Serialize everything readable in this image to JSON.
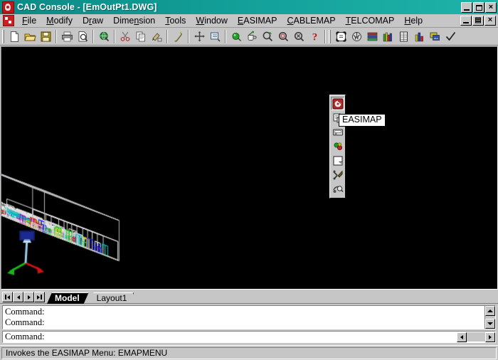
{
  "window": {
    "title": "CAD Console - [EmOutPt1.DWG]",
    "app_icon": "cad-console-icon",
    "controls": {
      "minimize": "_",
      "maximize": "□",
      "close": "×"
    }
  },
  "menubar": {
    "doc_icon": "document-control-icon",
    "items": [
      {
        "label": "File",
        "accel": "F"
      },
      {
        "label": "Modify",
        "accel": "M"
      },
      {
        "label": "Draw",
        "accel": "D"
      },
      {
        "label": "Dimension",
        "accel": "n"
      },
      {
        "label": "Tools",
        "accel": "T"
      },
      {
        "label": "Window",
        "accel": "W"
      },
      {
        "label": "EASIMAP",
        "accel": "E"
      },
      {
        "label": "CABLEMAP",
        "accel": "C"
      },
      {
        "label": "TELCOMAP",
        "accel": "T"
      },
      {
        "label": "Help",
        "accel": "H"
      }
    ],
    "mdi_controls": {
      "minimize": "_",
      "restore": "❐",
      "close": "×"
    }
  },
  "toolbar": {
    "groups": [
      [
        {
          "name": "new-icon",
          "label": "New"
        },
        {
          "name": "open-folder-icon",
          "label": "Open"
        },
        {
          "name": "save-disk-icon",
          "label": "Save"
        }
      ],
      [
        {
          "name": "print-icon",
          "label": "Print"
        },
        {
          "name": "print-preview-icon",
          "label": "Print Preview"
        }
      ],
      [
        {
          "name": "globe-find-icon",
          "label": "Find"
        }
      ],
      [
        {
          "name": "cut-icon",
          "label": "Cut"
        },
        {
          "name": "copy-icon",
          "label": "Copy"
        },
        {
          "name": "match-properties-icon",
          "label": "Match Properties"
        }
      ],
      [
        {
          "name": "pan-realtime-icon",
          "label": "Pan Realtime"
        },
        {
          "name": "undo-icon",
          "label": "Undo"
        }
      ],
      [
        {
          "name": "redo-globe-icon",
          "label": "Redo"
        },
        {
          "name": "insert-block-icon",
          "label": "Insert Block"
        },
        {
          "name": "zoom-in-icon",
          "label": "Zoom In"
        },
        {
          "name": "zoom-previous-icon",
          "label": "Zoom Previous"
        },
        {
          "name": "zoom-window-icon",
          "label": "Zoom Window"
        },
        {
          "name": "help-question-icon",
          "label": "Help"
        }
      ],
      [
        {
          "name": "properties-icon",
          "label": "Properties"
        },
        {
          "name": "render-icon",
          "label": "Render"
        },
        {
          "name": "layer-rack-icon",
          "label": "Layers"
        },
        {
          "name": "color-bars-icon",
          "label": "Colors"
        },
        {
          "name": "table-icon",
          "label": "Table"
        },
        {
          "name": "chart-bars-icon",
          "label": "Chart"
        },
        {
          "name": "image-attach-icon",
          "label": "Attach Image"
        },
        {
          "name": "checkmark-icon",
          "label": "Apply"
        }
      ]
    ]
  },
  "easimap_toolbar": {
    "name": "EASIMAP",
    "tooltip": "EASIMAP",
    "buttons": [
      {
        "name": "easimap-menu-icon",
        "label": "EASIMAP Menu",
        "selected": true
      },
      {
        "name": "easimap-database-icon",
        "label": "Database"
      },
      {
        "name": "easimap-equipment-icon",
        "label": "Equipment"
      },
      {
        "name": "easimap-node-icon",
        "label": "Node"
      },
      {
        "name": "easimap-floor-icon",
        "label": "Floor"
      },
      {
        "name": "easimap-tools-icon",
        "label": "Tools"
      },
      {
        "name": "easimap-query-icon",
        "label": "Query"
      }
    ]
  },
  "tabs": {
    "nav": [
      {
        "name": "first-tab-button",
        "glyph": "⏮"
      },
      {
        "name": "prev-tab-button",
        "glyph": "◀"
      },
      {
        "name": "next-tab-button",
        "glyph": "▶"
      },
      {
        "name": "last-tab-button",
        "glyph": "⏭"
      }
    ],
    "items": [
      {
        "label": "Model",
        "active": true
      },
      {
        "label": "Layout1",
        "active": false
      }
    ]
  },
  "command": {
    "history": [
      "Command:",
      "Command:"
    ],
    "input": "Command:",
    "scroll_up": "▲",
    "scroll_down": "▼",
    "scroll_left": "◀",
    "scroll_right": "▶"
  },
  "statusbar": {
    "message": "Invokes the EASIMAP Menu:  EMAPMENU"
  },
  "drawing": {
    "name": "cad-3d-wireframe-facility",
    "background": "#000000",
    "ucs_icon": "ucs-axis-icon",
    "watermark": "EASIMAP",
    "palette": {
      "white": "#e8e8e8",
      "cyan": "#00cfcf",
      "blue": "#1414e0",
      "yellow": "#c8c800",
      "green": "#00c800",
      "red": "#d01010",
      "magenta": "#c000c0",
      "gray": "#9a9a9a"
    }
  }
}
